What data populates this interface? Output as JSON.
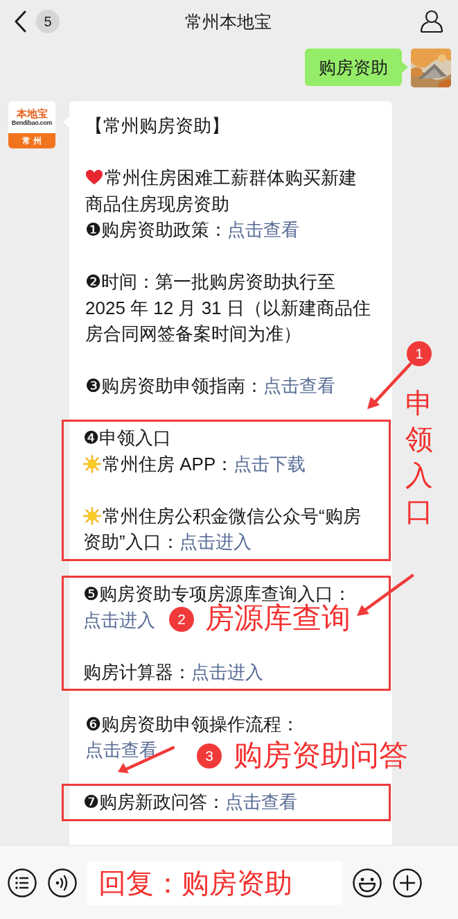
{
  "header": {
    "back_count": "5",
    "title": "常州本地宝"
  },
  "messages": [
    {
      "kind": "sent",
      "text": "购房资助"
    },
    {
      "kind": "received",
      "avatar": {
        "brand": "本地宝",
        "domain": "Bendibao.com",
        "city": "常 州"
      },
      "groups": [
        {
          "boxed": false,
          "blocks": [
            [
              {
                "kind": "text",
                "lines": [
                  "【常州购房资助】"
                ]
              }
            ],
            [
              {
                "kind": "heart",
                "lines": [
                  "常州住房困难工薪群体购买新建",
                  "商品住房现房资助"
                ]
              },
              {
                "kind": "text",
                "lines": [
                  "❶购房资助政策："
                ],
                "link": "点击查看"
              }
            ],
            [
              {
                "kind": "text",
                "lines": [
                  "❷时间：第一批购房资助执行至",
                  "2025 年 12 月 31 日（以新建商品住",
                  "房合同网签备案时间为准）"
                ]
              }
            ],
            [
              {
                "kind": "text",
                "lines": [
                  "❸购房资助申领指南："
                ],
                "link": "点击查看"
              }
            ]
          ]
        },
        {
          "boxed": true,
          "blocks": [
            [
              {
                "kind": "text",
                "lines": [
                  "❹申领入口"
                ]
              },
              {
                "kind": "sun",
                "lines": [
                  "常州住房 APP："
                ],
                "link": "点击下载"
              }
            ],
            [
              {
                "kind": "sun",
                "lines": [
                  "常州住房公积金微信公众号“购房",
                  "资助”入口："
                ],
                "link": "点击进入"
              }
            ]
          ]
        },
        {
          "boxed": true,
          "blocks": [
            [
              {
                "kind": "text",
                "lines": [
                  "❺购房资助专项房源库查询入口："
                ],
                "link": "点击进入"
              }
            ],
            [
              {
                "kind": "text",
                "lines": [
                  "购房计算器："
                ],
                "link": "点击进入"
              }
            ]
          ]
        },
        {
          "boxed": false,
          "blocks": [
            [
              {
                "kind": "text",
                "lines": [
                  "❻购房资助申领操作流程："
                ],
                "link": "点击查看"
              }
            ]
          ]
        },
        {
          "boxed": true,
          "blocks": [
            [
              {
                "kind": "text",
                "lines": [
                  "❼购房新政问答："
                ],
                "link": "点击查看"
              }
            ]
          ]
        }
      ]
    }
  ],
  "annotations": [
    {
      "kind": "vertical",
      "number": "1",
      "label": "申领入口"
    },
    {
      "kind": "horizontal",
      "number": "2",
      "label": "房源库查询"
    },
    {
      "kind": "horizontal",
      "number": "3",
      "label": "购房资助问答"
    }
  ],
  "input_bar": {
    "value": "回复：购房资助"
  }
}
